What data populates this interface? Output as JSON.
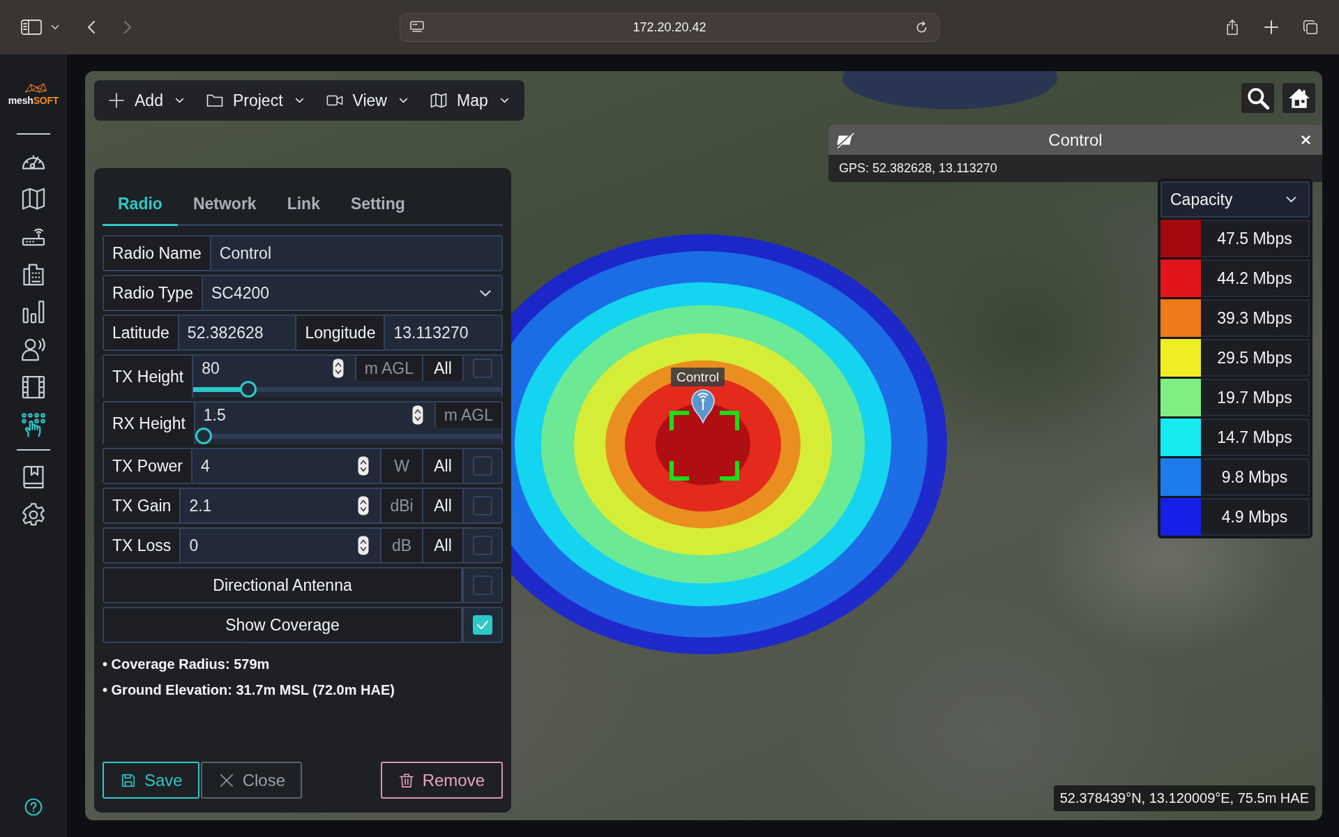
{
  "browser": {
    "address": "172.20.20.42",
    "back_disabled": false,
    "forward_disabled": true
  },
  "sidebar": {
    "logo": {
      "text": "mesh",
      "accent": "SOFT"
    },
    "nav_items": [
      {
        "selected": false
      },
      {
        "selected": false
      },
      {
        "selected": false
      },
      {
        "selected": false
      },
      {
        "selected": false
      },
      {
        "selected": false
      },
      {
        "selected": false
      },
      {
        "selected": true
      }
    ],
    "extra_items": [
      {
        "selected": false
      },
      {
        "selected": false
      }
    ]
  },
  "toolbar": {
    "menus": [
      {
        "label": "Add"
      },
      {
        "label": "Project"
      },
      {
        "label": "View"
      },
      {
        "label": "Map"
      }
    ]
  },
  "marker": {
    "label": "Control"
  },
  "popup": {
    "title": "Control",
    "gps": "GPS: 52.382628, 13.113270"
  },
  "legend": {
    "title": "Capacity",
    "items": [
      {
        "label": "47.5 Mbps",
        "color": "#a30a10"
      },
      {
        "label": "44.2 Mbps",
        "color": "#e2141c"
      },
      {
        "label": "39.3 Mbps",
        "color": "#ee7a1a"
      },
      {
        "label": "29.5 Mbps",
        "color": "#eeee22"
      },
      {
        "label": "19.7 Mbps",
        "color": "#80ee80"
      },
      {
        "label": "14.7 Mbps",
        "color": "#14eaf0"
      },
      {
        "label": "9.8 Mbps",
        "color": "#1c7cec"
      },
      {
        "label": "4.9 Mbps",
        "color": "#1420e6"
      }
    ]
  },
  "panel": {
    "tabs": [
      {
        "label": "Radio",
        "selected": true
      },
      {
        "label": "Network",
        "selected": false
      },
      {
        "label": "Link",
        "selected": false
      },
      {
        "label": "Setting",
        "selected": false
      }
    ],
    "fields": [
      {
        "kind": "text",
        "label": "Radio Name",
        "value": "Control"
      },
      {
        "kind": "select",
        "label": "Radio Type",
        "value": "SC4200"
      },
      {
        "kind": "pair",
        "cells": [
          {
            "label": "Latitude",
            "value": "52.382628"
          },
          {
            "label": "Longitude",
            "value": "13.113270"
          }
        ]
      },
      {
        "kind": "number",
        "label": "TX Height",
        "value": "80",
        "unit": "m AGL",
        "all": "All",
        "checked": false,
        "level": 0.16
      },
      {
        "kind": "number",
        "label": "RX Height",
        "value": "1.5",
        "unit": "m AGL",
        "level": 0
      },
      {
        "kind": "number",
        "label": "TX Power",
        "value": "4",
        "unit": "W",
        "all": "All",
        "checked": false
      },
      {
        "kind": "number",
        "label": "TX Gain",
        "value": "2.1",
        "unit": "dBi",
        "all": "All",
        "checked": false
      },
      {
        "kind": "number",
        "label": "TX Loss",
        "value": "0",
        "unit": "dB",
        "all": "All",
        "checked": false
      },
      {
        "kind": "toggle",
        "label": "Directional Antenna",
        "checked": false
      },
      {
        "kind": "toggle",
        "label": "Show Coverage",
        "checked": true
      }
    ],
    "info": [
      "• Coverage Radius: 579m",
      "• Ground Elevation: 31.7m MSL (72.0m HAE)"
    ],
    "buttons": [
      {
        "label": "Save",
        "kind": "save"
      },
      {
        "label": "Close",
        "kind": "close"
      },
      {
        "label": "Remove",
        "kind": "remove"
      }
    ]
  },
  "cursor_position": "52.378439°N, 13.120009°E, 75.5m HAE"
}
